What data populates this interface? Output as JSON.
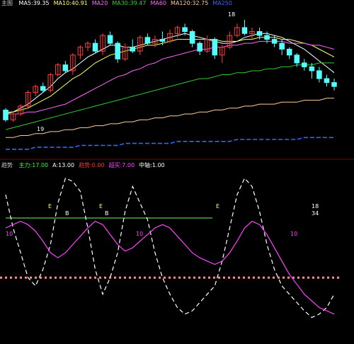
{
  "colors": {
    "background": "#000000",
    "candle_up": "#ff3b3b",
    "candle_down": "#54ffff",
    "ma5": "#ffffff",
    "ma10": "#ffff66",
    "ma20": "#ff66ff",
    "ma60": "#33cc33",
    "ma120": "#ffcc99",
    "ma250": "#3366ff",
    "white_line": "#ffffff",
    "magenta_line": "#ff44ff",
    "threshold_green": "#66ff66",
    "threshold_dotted": "#ff8a8a",
    "divider": "#7a0000"
  },
  "top_panel": {
    "title": "主图",
    "ma_readouts": [
      {
        "label": "MA5",
        "value": "39.35",
        "color": "#ffffff"
      },
      {
        "label": "MA10",
        "value": "40.91",
        "color": "#ffff66"
      },
      {
        "label": "MA20",
        "value": "",
        "color": "#ff66ff"
      },
      {
        "label": "MA30",
        "value": "39.47",
        "color": "#33cc33"
      },
      {
        "label": "MA60",
        "value": "",
        "color": "#ff66ff"
      },
      {
        "label": "MA120",
        "value": "32.75",
        "color": "#ffcc99"
      },
      {
        "label": "MA250",
        "value": "",
        "color": "#3366ff"
      }
    ],
    "annotations": {
      "high_label": "18",
      "low_label": "19"
    }
  },
  "indicator_panel": {
    "title": "趋势",
    "readouts": [
      {
        "label": "主力",
        "value": "17.00",
        "color": "#33ff33"
      },
      {
        "label": "A",
        "value": "13.00",
        "color": "#ffffff"
      },
      {
        "label": "趋势",
        "value": "0.00",
        "color": "#ff3333"
      },
      {
        "label": "超买",
        "value": "7.00",
        "color": "#ff44ff"
      },
      {
        "label": "中轴",
        "value": "1.00",
        "color": "#ffffff"
      }
    ],
    "markers": [
      {
        "text": "E",
        "color": "#ffff66"
      },
      {
        "text": "B",
        "color": "#ffffff"
      },
      {
        "text": "E",
        "color": "#ffff66"
      },
      {
        "text": "B",
        "color": "#ffffff"
      },
      {
        "text": "E",
        "color": "#ffff66"
      },
      {
        "text": "18",
        "color": "#ffffff"
      },
      {
        "text": "34",
        "color": "#ffffff"
      },
      {
        "text": "10",
        "color": "#ff44ff"
      },
      {
        "text": "10",
        "color": "#ff44ff"
      },
      {
        "text": "10",
        "color": "#ff44ff"
      }
    ]
  },
  "chart_data": {
    "type": "candlestick",
    "candles": [
      [
        24,
        19,
        25,
        18
      ],
      [
        19,
        22,
        23,
        18
      ],
      [
        22,
        26,
        27,
        21
      ],
      [
        26,
        33,
        34,
        25
      ],
      [
        33,
        36,
        37,
        31
      ],
      [
        36,
        34,
        38,
        33
      ],
      [
        34,
        42,
        43,
        33
      ],
      [
        42,
        47,
        48,
        41
      ],
      [
        47,
        44,
        49,
        43
      ],
      [
        44,
        52,
        53,
        42
      ],
      [
        52,
        56,
        57,
        50
      ],
      [
        56,
        58,
        59,
        54
      ],
      [
        58,
        54,
        60,
        53
      ],
      [
        54,
        62,
        63,
        52
      ],
      [
        62,
        58,
        64,
        57
      ],
      [
        58,
        50,
        59,
        48
      ],
      [
        50,
        56,
        58,
        49
      ],
      [
        56,
        54,
        60,
        53
      ],
      [
        54,
        61,
        62,
        52
      ],
      [
        61,
        58,
        63,
        57
      ],
      [
        58,
        60,
        62,
        56
      ],
      [
        60,
        59,
        64,
        57
      ],
      [
        59,
        63,
        65,
        58
      ],
      [
        63,
        66,
        67,
        61
      ],
      [
        66,
        64,
        68,
        62
      ],
      [
        64,
        58,
        65,
        56
      ],
      [
        58,
        54,
        59,
        52
      ],
      [
        54,
        60,
        62,
        53
      ],
      [
        60,
        52,
        61,
        50
      ],
      [
        52,
        56,
        57,
        48
      ],
      [
        56,
        62,
        64,
        55
      ],
      [
        62,
        66,
        68,
        61
      ],
      [
        66,
        63,
        70,
        62
      ],
      [
        63,
        64,
        66,
        60
      ],
      [
        64,
        62,
        66,
        60
      ],
      [
        62,
        60,
        64,
        58
      ],
      [
        60,
        58,
        62,
        56
      ],
      [
        58,
        55,
        60,
        52
      ],
      [
        55,
        52,
        56,
        50
      ],
      [
        52,
        48,
        53,
        46
      ],
      [
        48,
        46,
        50,
        44
      ],
      [
        46,
        44,
        48,
        40
      ],
      [
        44,
        40,
        46,
        38
      ],
      [
        40,
        38,
        42,
        36
      ],
      [
        38,
        36,
        40,
        34
      ]
    ],
    "ma_series": [
      {
        "name": "MA5",
        "values": [
          22,
          23,
          25,
          27,
          30,
          33,
          36,
          40,
          43,
          45,
          48,
          51,
          53,
          55,
          57,
          57,
          56,
          56,
          57,
          58,
          59,
          60,
          61,
          62,
          63,
          62,
          61,
          60,
          59,
          58,
          58,
          59,
          61,
          62,
          63,
          63,
          62,
          61,
          59,
          57,
          55,
          52,
          49,
          46,
          43
        ]
      },
      {
        "name": "MA10",
        "values": [
          23,
          23,
          24,
          25,
          27,
          29,
          31,
          34,
          37,
          40,
          42,
          45,
          48,
          50,
          52,
          53,
          54,
          55,
          56,
          57,
          57,
          58,
          59,
          60,
          60,
          60,
          60,
          60,
          60,
          59,
          59,
          59,
          60,
          60,
          61,
          61,
          61,
          60,
          60,
          59,
          58,
          57,
          55,
          53,
          51
        ]
      },
      {
        "name": "MA20",
        "values": [
          22,
          22,
          22,
          23,
          23,
          24,
          25,
          26,
          27,
          29,
          31,
          33,
          35,
          37,
          39,
          41,
          42,
          44,
          45,
          47,
          48,
          50,
          51,
          52,
          53,
          54,
          55,
          55,
          56,
          56,
          57,
          57,
          58,
          58,
          59,
          59,
          59,
          59,
          58,
          58,
          58,
          57,
          57,
          56,
          55
        ]
      },
      {
        "name": "MA60",
        "values": [
          14,
          15,
          16,
          17,
          18,
          19,
          20,
          21,
          22,
          23,
          24,
          25,
          26,
          27,
          28,
          29,
          30,
          31,
          32,
          33,
          34,
          35,
          36,
          37,
          38,
          39,
          40,
          40,
          41,
          42,
          42,
          43,
          43,
          44,
          44,
          45,
          45,
          46,
          46,
          47,
          47,
          47,
          48,
          48,
          48
        ]
      },
      {
        "name": "MA120",
        "values": [
          10,
          10,
          11,
          11,
          12,
          12,
          13,
          13,
          14,
          14,
          15,
          15,
          16,
          16,
          17,
          17,
          18,
          18,
          19,
          19,
          20,
          20,
          21,
          21,
          22,
          22,
          23,
          23,
          24,
          24,
          25,
          25,
          26,
          26,
          27,
          27,
          27,
          28,
          28,
          28,
          29,
          29,
          29,
          30,
          30
        ]
      },
      {
        "name": "MA250",
        "values": [
          4,
          4,
          4,
          4,
          5,
          5,
          5,
          5,
          5,
          5,
          6,
          6,
          6,
          6,
          6,
          6,
          7,
          7,
          7,
          7,
          7,
          7,
          7,
          8,
          8,
          8,
          8,
          8,
          8,
          8,
          8,
          9,
          9,
          9,
          9,
          9,
          9,
          9,
          9,
          9,
          10,
          10,
          10,
          10,
          10
        ]
      }
    ],
    "indicator_series": [
      {
        "name": "A",
        "values": [
          90,
          70,
          55,
          40,
          35,
          45,
          60,
          85,
          100,
          98,
          92,
          70,
          45,
          30,
          40,
          55,
          80,
          95,
          85,
          75,
          55,
          40,
          30,
          22,
          18,
          20,
          25,
          30,
          35,
          50,
          70,
          90,
          100,
          95,
          80,
          60,
          45,
          35,
          30,
          25,
          20,
          16,
          18,
          22,
          30
        ]
      },
      {
        "name": "超买",
        "values": [
          70,
          72,
          74,
          72,
          68,
          62,
          55,
          52,
          55,
          60,
          65,
          70,
          74,
          72,
          66,
          60,
          56,
          58,
          62,
          66,
          70,
          72,
          70,
          65,
          60,
          55,
          52,
          50,
          48,
          50,
          55,
          62,
          70,
          74,
          72,
          66,
          58,
          50,
          42,
          36,
          30,
          26,
          22,
          20,
          18
        ]
      }
    ],
    "indicator_thresholds": {
      "upper": 76,
      "middle": 40
    },
    "ylim_price": [
      0,
      75
    ],
    "ylim_indicator": [
      0,
      105
    ]
  }
}
